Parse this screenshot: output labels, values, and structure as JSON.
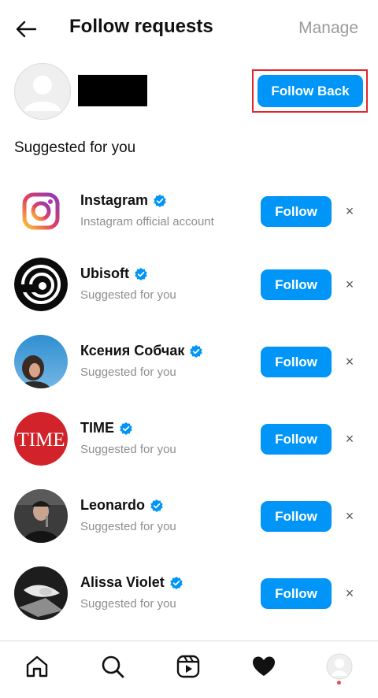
{
  "header": {
    "title": "Follow requests",
    "manage_label": "Manage"
  },
  "request": {
    "follow_back_label": "Follow Back"
  },
  "section": {
    "title": "Suggested for you"
  },
  "suggestions": [
    {
      "name": "Instagram",
      "subtitle": "Instagram official account",
      "follow_label": "Follow",
      "dismiss": "×",
      "avatar": "instagram-logo"
    },
    {
      "name": "Ubisoft",
      "subtitle": "Suggested for you",
      "follow_label": "Follow",
      "dismiss": "×",
      "avatar": "ubisoft-logo"
    },
    {
      "name": "Ксения Собчак",
      "subtitle": "Suggested for you",
      "follow_label": "Follow",
      "dismiss": "×",
      "avatar": "person-photo"
    },
    {
      "name": "TIME",
      "subtitle": "Suggested for you",
      "follow_label": "Follow",
      "dismiss": "×",
      "avatar": "time-logo"
    },
    {
      "name": "Leonardo",
      "subtitle": "Suggested for you",
      "follow_label": "Follow",
      "dismiss": "×",
      "avatar": "person-photo"
    },
    {
      "name": "Alissa Violet",
      "subtitle": "Suggested for you",
      "follow_label": "Follow",
      "dismiss": "×",
      "avatar": "person-photo"
    }
  ],
  "tabs": [
    "home-icon",
    "search-icon",
    "reels-icon",
    "heart-icon",
    "profile-icon"
  ],
  "colors": {
    "accent": "#0095f6",
    "highlight": "#e0262f",
    "muted": "#8e8e8e",
    "verified": "#0095f6"
  }
}
